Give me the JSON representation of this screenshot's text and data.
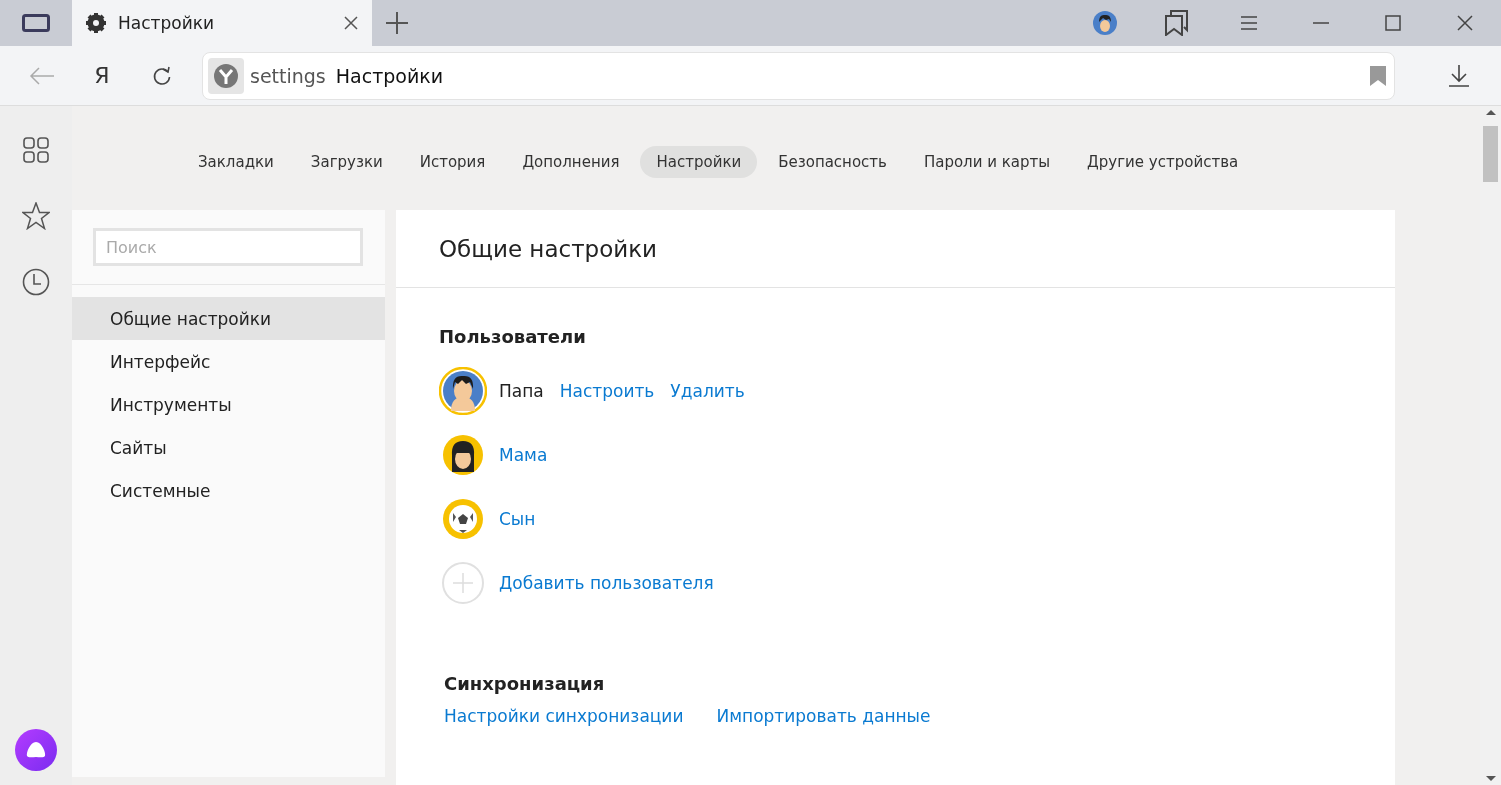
{
  "browser_tab": {
    "title": "Настройки"
  },
  "address_bar": {
    "scheme": "settings",
    "title": "Настройки"
  },
  "yandex_button": {
    "label": "Я"
  },
  "nav_tabs": [
    {
      "label": "Закладки",
      "selected": false
    },
    {
      "label": "Загрузки",
      "selected": false
    },
    {
      "label": "История",
      "selected": false
    },
    {
      "label": "Дополнения",
      "selected": false
    },
    {
      "label": "Настройки",
      "selected": true
    },
    {
      "label": "Безопасность",
      "selected": false
    },
    {
      "label": "Пароли и карты",
      "selected": false
    },
    {
      "label": "Другие устройства",
      "selected": false
    }
  ],
  "sidebar": {
    "search": {
      "placeholder": "Поиск"
    },
    "items": [
      {
        "label": "Общие настройки",
        "selected": true
      },
      {
        "label": "Интерфейс",
        "selected": false
      },
      {
        "label": "Инструменты",
        "selected": false
      },
      {
        "label": "Сайты",
        "selected": false
      },
      {
        "label": "Системные",
        "selected": false
      }
    ]
  },
  "content": {
    "title": "Общие настройки",
    "users": {
      "heading": "Пользователи",
      "items": [
        {
          "kind": "man",
          "name": "Папа",
          "selected": true,
          "actions": [
            "Настроить",
            "Удалить"
          ]
        },
        {
          "kind": "woman",
          "name": "Мама",
          "selected": false
        },
        {
          "kind": "ball",
          "name": "Сын",
          "selected": false
        },
        {
          "kind": "add",
          "name": "Добавить пользователя",
          "selected": false
        }
      ]
    },
    "sync": {
      "heading": "Синхронизация",
      "links": [
        "Настройки синхронизации",
        "Импортировать данные"
      ]
    }
  }
}
